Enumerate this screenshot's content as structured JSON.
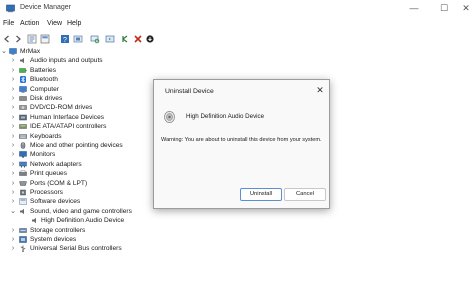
{
  "window": {
    "title": "Device Manager",
    "controls": [
      "—",
      "☐",
      "✕"
    ]
  },
  "menubar": {
    "items": [
      "File",
      "Action",
      "View",
      "Help"
    ]
  },
  "toolbar": {
    "buttons": [
      "back-icon",
      "forward-icon",
      "properties-icon",
      "help-icon",
      "show-hidden-icon",
      "scan-icon",
      "update-driver-icon",
      "disable-icon",
      "uninstall-icon",
      "refresh-icon"
    ]
  },
  "tree": {
    "root": "MrMax",
    "items": [
      "Audio inputs and outputs",
      "Batteries",
      "Bluetooth",
      "Computer",
      "Disk drives",
      "DVD/CD-ROM drives",
      "Human Interface Devices",
      "IDE ATA/ATAPI controllers",
      "Keyboards",
      "Mice and other pointing devices",
      "Monitors",
      "Network adapters",
      "Print queues",
      "Ports (COM & LPT)",
      "Processors",
      "Software devices",
      "Sound, video and game controllers",
      "High Definition Audio Device",
      "Storage controllers",
      "System devices",
      "Universal Serial Bus controllers"
    ]
  },
  "dialog": {
    "title": "Uninstall Device",
    "close": "✕",
    "device_name": "High Definition Audio Device",
    "warning": "Warning: You are about to uninstall this device from your system.",
    "uninstall_label": "Uninstall",
    "cancel_label": "Cancel"
  }
}
